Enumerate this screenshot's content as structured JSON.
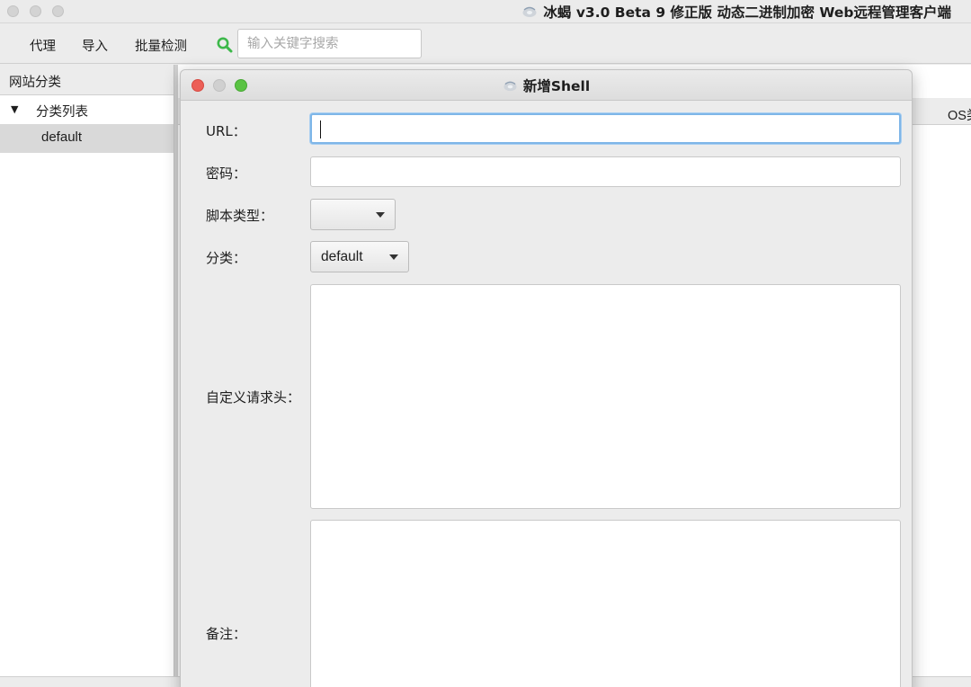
{
  "window": {
    "title": "冰蝎 v3.0 Beta 9 修正版 动态二进制加密 Web远程管理客户端"
  },
  "menu": {
    "items": [
      "代理",
      "导入",
      "批量检测"
    ],
    "search_placeholder": "输入关键字搜索"
  },
  "sidebar": {
    "header": "网站分类",
    "tree_root": "分类列表",
    "tree_items": [
      "default"
    ]
  },
  "table": {
    "visible_column_fragment": "OS类"
  },
  "dialog": {
    "title": "新增Shell",
    "fields": {
      "url_label": "URL：",
      "url_value": "",
      "password_label": "密码：",
      "password_value": "",
      "script_type_label": "脚本类型：",
      "script_type_value": "",
      "category_label": "分类：",
      "category_value": "default",
      "headers_label": "自定义请求头：",
      "headers_value": "",
      "notes_label": "备注：",
      "notes_value": ""
    },
    "colors": {
      "close": "#ec5f57",
      "minimize": "#d0d0d0",
      "maximize": "#5ac343",
      "focus_ring": "#7eb6e8"
    }
  }
}
